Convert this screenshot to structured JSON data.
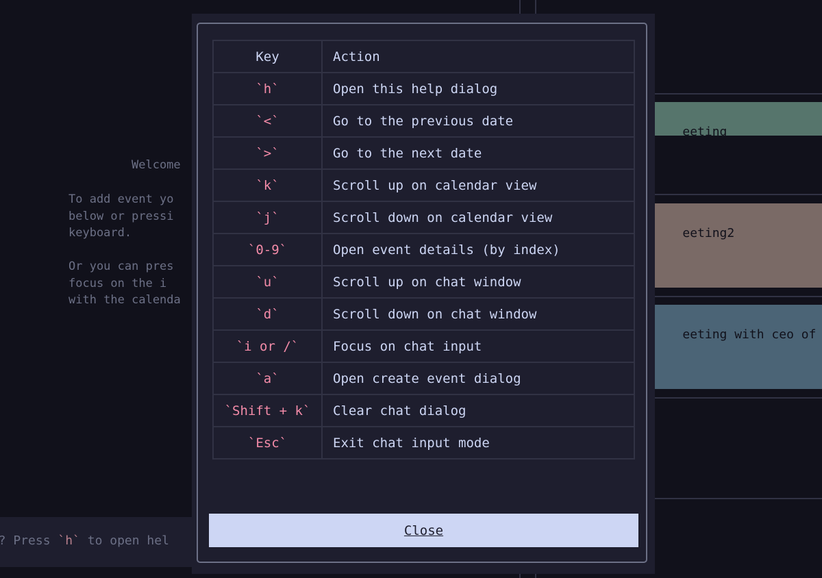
{
  "welcome": {
    "title": "Welcome",
    "lines": "To add event yo\nbelow or pressi\nkeyboard.\n\nOr you can pres\nfocus on the i\nwith the calenda"
  },
  "bottom": {
    "hint_prefix": "lp? Press ",
    "hint_key": "`h`",
    "hint_suffix": " to open hel"
  },
  "events": [
    {
      "title": "eeting",
      "color": "#56756c"
    },
    {
      "title": "eeting2",
      "color": "#7a6a66"
    },
    {
      "title": "eeting with ceo of htm",
      "color": "#4b6476"
    }
  ],
  "help_dialog": {
    "headers": {
      "key": "Key",
      "action": "Action"
    },
    "rows": [
      {
        "key": "`h`",
        "action": "Open this help dialog"
      },
      {
        "key": "`<`",
        "action": "Go to the previous date"
      },
      {
        "key": "`>`",
        "action": "Go to the next date"
      },
      {
        "key": "`k`",
        "action": "Scroll up on calendar view"
      },
      {
        "key": "`j`",
        "action": "Scroll down on calendar view"
      },
      {
        "key": "`0-9`",
        "action": "Open event details (by index)"
      },
      {
        "key": "`u`",
        "action": "Scroll up on chat window"
      },
      {
        "key": "`d`",
        "action": "Scroll down on chat window"
      },
      {
        "key": "`i or /`",
        "action": "Focus on chat input"
      },
      {
        "key": "`a`",
        "action": "Open create event dialog"
      },
      {
        "key": "`Shift + k`",
        "action": "Clear chat dialog"
      },
      {
        "key": "`Esc`",
        "action": "Exit chat input mode"
      }
    ],
    "close_label": "Close"
  },
  "colors": {
    "background": "#11111b",
    "modal": "#1e1e2e",
    "key_text": "#f38ba8",
    "text": "#cdd6f4",
    "close_button": "#cdd6f4"
  }
}
